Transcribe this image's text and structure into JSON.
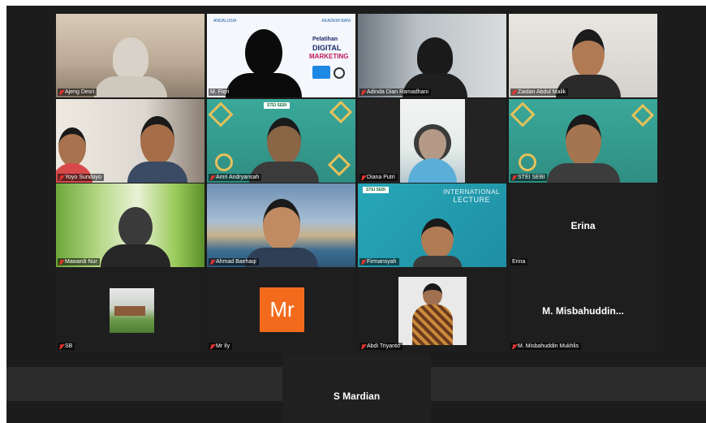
{
  "participants": [
    {
      "name": "Ajeng Desri"
    },
    {
      "name": "M. Fiqri"
    },
    {
      "name": "Adinda Dian Ramadhani"
    },
    {
      "name": "Zaidan Abdul Malik"
    },
    {
      "name": "Yoyo Sundoyo"
    },
    {
      "name": "Amri Andryansah"
    },
    {
      "name": "Diana Putri"
    },
    {
      "name": "STEI SEBI"
    },
    {
      "name": "Mawardi Nur"
    },
    {
      "name": "Ahmad Baehaqi"
    },
    {
      "name": "Firmansyah"
    },
    {
      "name": "Erina",
      "display": "Erina"
    },
    {
      "name": "SB"
    },
    {
      "name": "Mr Ily",
      "avatar": "Mr"
    },
    {
      "name": "Abdi Triyanto"
    },
    {
      "name": "M. Misbahuddin Mukhlis",
      "display": "M. Misbahuddin..."
    }
  ],
  "spotlight": {
    "display": "S Mardian"
  },
  "slides": {
    "fiqri_top_left": "ANDALUSIA",
    "fiqri_top_right": "AKADEMI BANI",
    "fiqri_title_1": "Pelatihan",
    "fiqri_title_2": "DIGITAL",
    "fiqri_title_3": "MARKETING",
    "lecture_line_1": "INTERNATIONAL",
    "lecture_line_2": "LECTURE",
    "stei_logo": "STEI SEBI"
  },
  "colors": {
    "muted_mic": "#e0332f",
    "active_border": "#23d18b",
    "avatar_bg": "#f26b1d"
  }
}
